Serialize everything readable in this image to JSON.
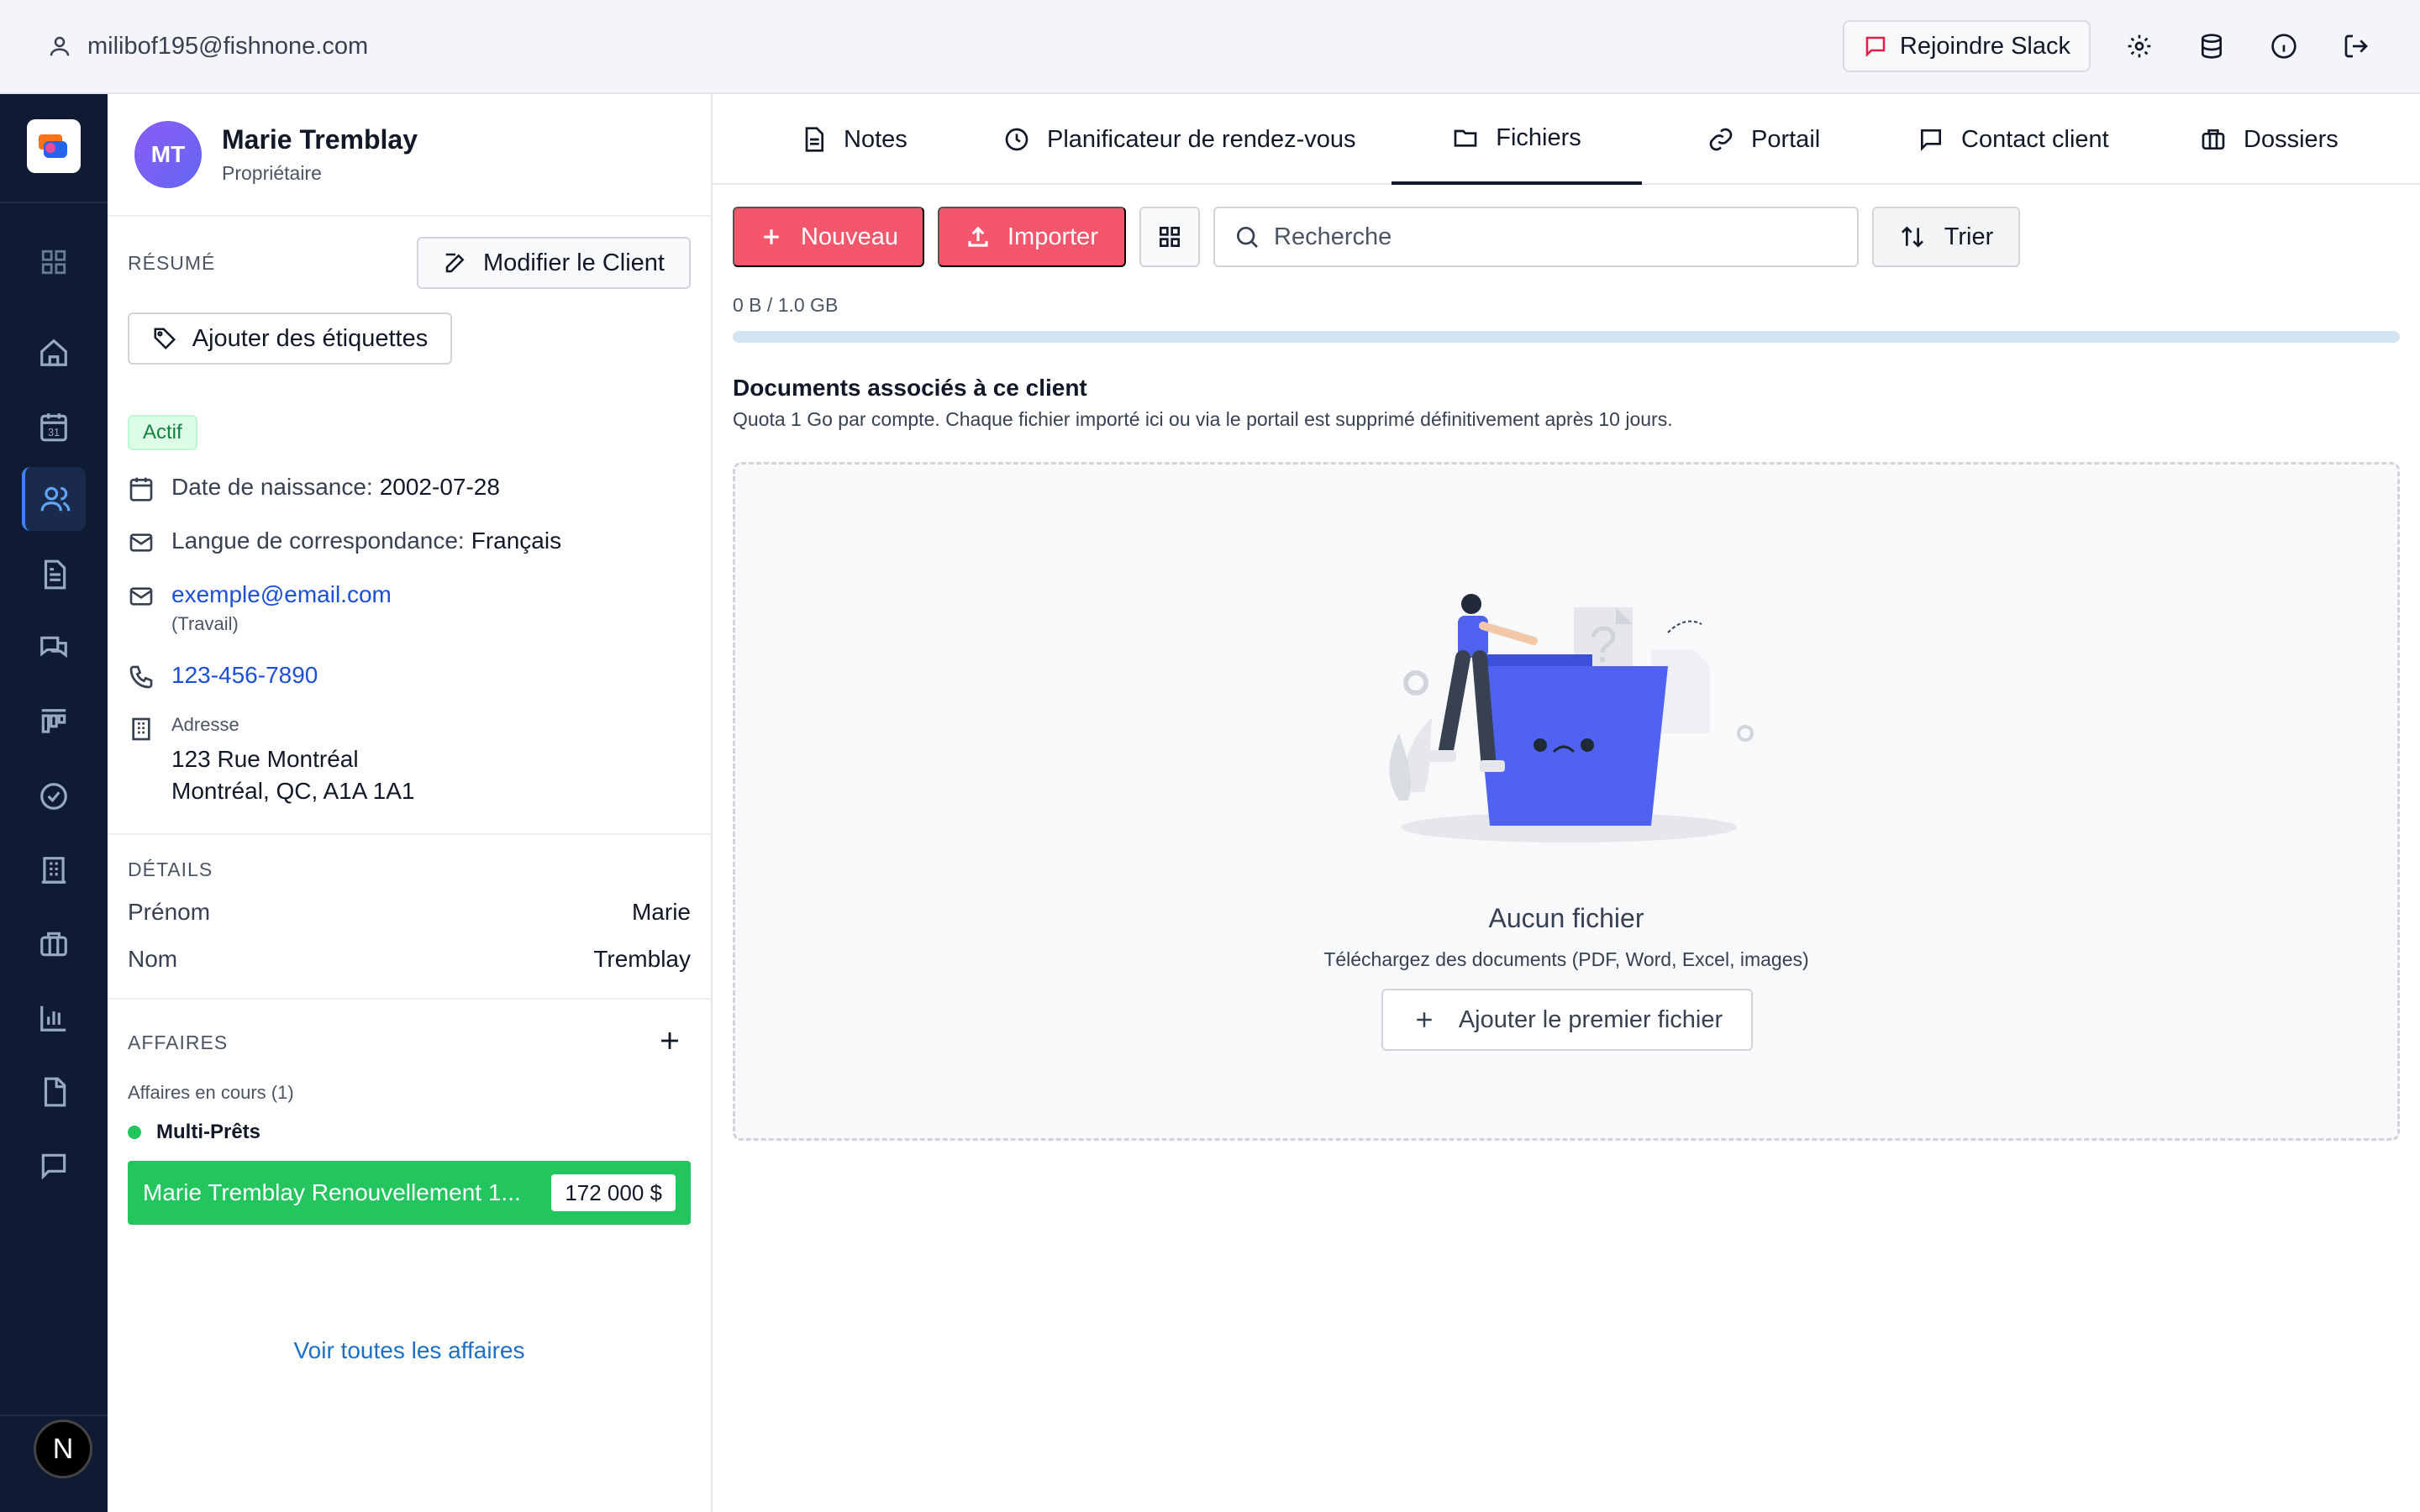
{
  "topbar": {
    "user_email": "milibof195@fishnone.com",
    "slack_label": "Rejoindre Slack",
    "icons": [
      "user-icon",
      "slack-icon",
      "gear-icon",
      "database-icon",
      "info-icon",
      "logout-icon"
    ]
  },
  "rail": {
    "logo_name": "app-logo",
    "items": [
      "grid-icon",
      "home-icon",
      "calendar-icon",
      "users-icon",
      "document-icon",
      "chat-icon",
      "board-icon",
      "check-circle-icon",
      "building-icon",
      "briefcase-icon",
      "bar-chart-icon",
      "file-icon",
      "message-icon"
    ],
    "calendar_day": "31",
    "active_item": "users-icon",
    "footer_avatar": "N"
  },
  "client": {
    "initials": "MT",
    "name": "Marie Tremblay",
    "role": "Propriétaire",
    "summary_label": "RÉSUMÉ",
    "edit_label": "Modifier le Client",
    "tags_label": "Ajouter des étiquettes",
    "status": "Actif",
    "birth_label": "Date de naissance:",
    "birth_value": "2002-07-28",
    "lang_label": "Langue de correspondance:",
    "lang_value": "Français",
    "email": "exemple@email.com",
    "email_type": "(Travail)",
    "phone": "123-456-7890",
    "address_label": "Adresse",
    "address_line1": "123 Rue Montréal",
    "address_line2": "Montréal, QC, A1A 1A1",
    "details_label": "DÉTAILS",
    "details": [
      {
        "label": "Prénom",
        "value": "Marie"
      },
      {
        "label": "Nom",
        "value": "Tremblay"
      }
    ],
    "deals_label": "AFFAIRES",
    "deals_open": "Affaires en cours (1)",
    "pipeline": "Multi-Prêts",
    "deal_title": "Marie Tremblay Renouvellement 1...",
    "deal_amount": "172 000 $",
    "view_all": "Voir toutes les affaires"
  },
  "tabs": [
    {
      "label": "Notes",
      "icon": "note-icon"
    },
    {
      "label": "Planificateur de rendez-vous",
      "icon": "clock-icon"
    },
    {
      "label": "Fichiers",
      "icon": "folder-icon",
      "active": true
    },
    {
      "label": "Portail",
      "icon": "link-icon"
    },
    {
      "label": "Contact client",
      "icon": "chat-icon"
    },
    {
      "label": "Dossiers",
      "icon": "briefcase-icon"
    }
  ],
  "toolbar": {
    "new_label": "Nouveau",
    "import_label": "Importer",
    "search_placeholder": "Recherche",
    "sort_label": "Trier"
  },
  "files": {
    "quota_text": "0 B / 1.0 GB",
    "quota_used": 0,
    "title": "Documents associés à ce client",
    "subtitle": "Quota 1 Go par compte. Chaque fichier importé ici ou via le portail est supprimé définitivement après 10 jours.",
    "empty_title": "Aucun fichier",
    "empty_sub": "Téléchargez des documents (PDF, Word, Excel, images)",
    "add_first": "Ajouter le premier fichier"
  },
  "colors": {
    "rail_bg": "#0f1b33",
    "accent_red": "#f4566b",
    "deal_green": "#22c55e",
    "folder_blue": "#4f63f0",
    "link_blue": "#1d4ed8"
  }
}
